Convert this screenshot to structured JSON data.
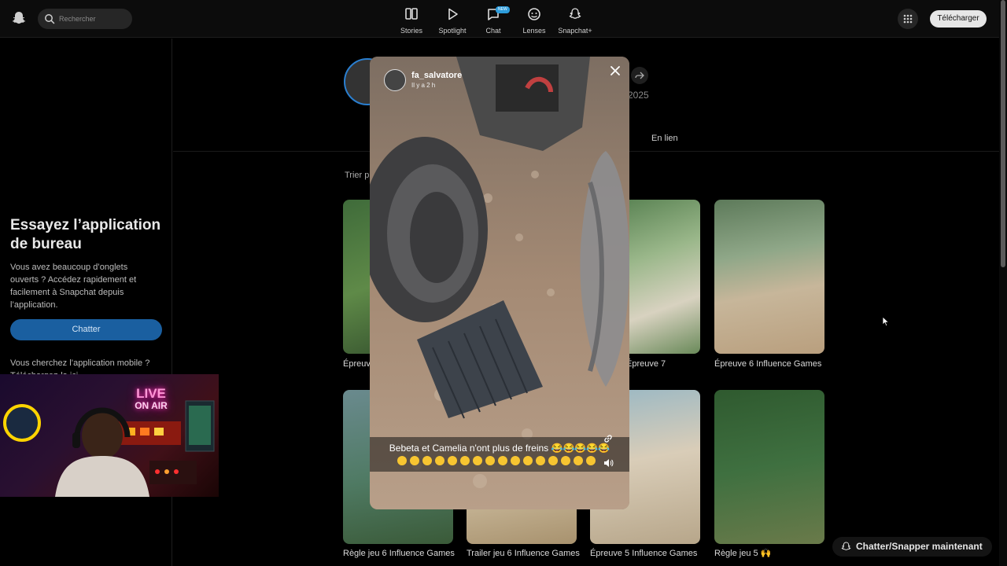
{
  "search": {
    "placeholder": "Rechercher"
  },
  "nav": [
    {
      "label": "Stories",
      "icon": "stories-icon"
    },
    {
      "label": "Spotlight",
      "icon": "spotlight-icon"
    },
    {
      "label": "Chat",
      "icon": "chat-icon",
      "badge": "NEW"
    },
    {
      "label": "Lenses",
      "icon": "lenses-icon"
    },
    {
      "label": "Snapchat+",
      "icon": "snapchat-plus-icon"
    }
  ],
  "header": {
    "download_label": "Télécharger"
  },
  "sidebar": {
    "title": "Essayez l’application de bureau",
    "text": "Vous avez beaucoup d’onglets ouverts ? Accédez rapidement et facilement à Snapchat depuis l’application.",
    "chat_button": "Chatter",
    "text2": "Vous cherchez l’application mobile&nbsp;? Téléchargez-la ici."
  },
  "webcam": {
    "sign_line1": "LIVE",
    "sign_line2": "ON AIR"
  },
  "profile": {
    "year_fragment": "2025",
    "tab_label": "En lien",
    "sort_fragment": "Trier p"
  },
  "tiles": [
    {
      "caption": "Épreuve 7",
      "icon": "sparkle-icon"
    },
    {
      "caption": "Épreuve 6 Influence Games",
      "icon": "emoji"
    },
    {
      "caption": "Règle jeu 6 Influence Games",
      "icon": "emoji"
    },
    {
      "caption": "Trailer jeu 6 Influence Games",
      "icon": "emoji"
    },
    {
      "caption": "Épreuve 5 Influence Games",
      "icon": "emoji"
    },
    {
      "caption": "Règle jeu 5 🙌",
      "icon": "emoji"
    }
  ],
  "story": {
    "username": "fa_salvatore",
    "time": "Il y a 2 h",
    "caption": "Bebeta et Camelia n'ont plus de freins 😂😂😂😂😂"
  },
  "bottom_button": "Chatter/Snapper maintenant",
  "colors": {
    "accent_blue": "#1a5fa0",
    "badge_blue": "#2d9cdb",
    "background": "#000000"
  }
}
